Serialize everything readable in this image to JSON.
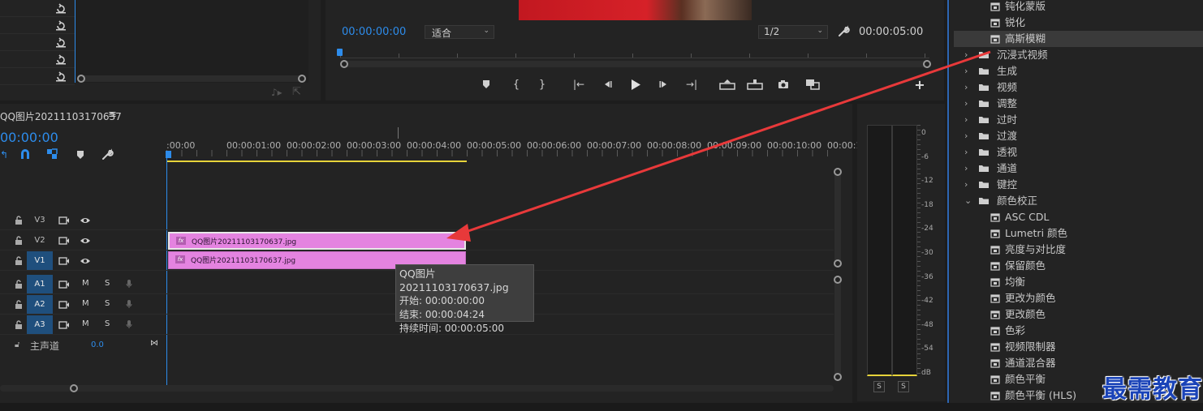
{
  "program_monitor": {
    "current_time": "00:00:00:00",
    "fit_option": "适合",
    "resolution": "1/2",
    "duration": "00:00:05:00"
  },
  "timeline": {
    "sequence_name": "QQ图片20211103170637",
    "timecode": "00:00:00",
    "ruler": [
      ":00:00",
      "00:00:01:00",
      "00:00:02:00",
      "00:00:03:00",
      "00:00:04:00",
      "00:00:05:00",
      "00:00:06:00",
      "00:00:07:00",
      "00:00:08:00",
      "00:00:09:00",
      "00:00:10:00",
      "00:00:1"
    ],
    "video_tracks": [
      {
        "name": "V3",
        "selected": false
      },
      {
        "name": "V2",
        "selected": false
      },
      {
        "name": "V1",
        "selected": true
      }
    ],
    "audio_tracks": [
      {
        "name": "A1",
        "mute": "M",
        "solo": "S"
      },
      {
        "name": "A2",
        "mute": "M",
        "solo": "S"
      },
      {
        "name": "A3",
        "mute": "M",
        "solo": "S"
      }
    ],
    "master": {
      "label": "主声道",
      "value": "0.0"
    },
    "clips": [
      {
        "track": "V2",
        "fx": "fx",
        "name": "QQ图片20211103170637.jpg"
      },
      {
        "track": "V1",
        "fx": "fx",
        "name": "QQ图片20211103170637.jpg"
      }
    ],
    "tooltip": {
      "name": "QQ图片20211103170637.jpg",
      "start": "开始: 00:00:00:00",
      "end": "结束: 00:00:04:24",
      "duration": "持续时间: 00:00:05:00"
    }
  },
  "audio_meter": {
    "scale": [
      "0",
      "-6",
      "-12",
      "-18",
      "-24",
      "-30",
      "-36",
      "-42",
      "-48",
      "-54",
      "dB"
    ],
    "solo_labels": [
      "S",
      "S"
    ]
  },
  "effects_panel": {
    "items": [
      {
        "type": "effect",
        "label": "钝化蒙版",
        "indent": 2
      },
      {
        "type": "effect",
        "label": "锐化",
        "indent": 2
      },
      {
        "type": "effect",
        "label": "高斯模糊",
        "indent": 2,
        "highlighted": true
      },
      {
        "type": "folder",
        "label": "沉浸式视频",
        "expanded": false
      },
      {
        "type": "folder",
        "label": "生成",
        "expanded": false
      },
      {
        "type": "folder",
        "label": "视频",
        "expanded": false
      },
      {
        "type": "folder",
        "label": "调整",
        "expanded": false
      },
      {
        "type": "folder",
        "label": "过时",
        "expanded": false
      },
      {
        "type": "folder",
        "label": "过渡",
        "expanded": false
      },
      {
        "type": "folder",
        "label": "透视",
        "expanded": false
      },
      {
        "type": "folder",
        "label": "通道",
        "expanded": false
      },
      {
        "type": "folder",
        "label": "键控",
        "expanded": false
      },
      {
        "type": "folder",
        "label": "颜色校正",
        "expanded": true
      },
      {
        "type": "effect",
        "label": "ASC CDL",
        "indent": 2
      },
      {
        "type": "effect",
        "label": "Lumetri 颜色",
        "indent": 2
      },
      {
        "type": "effect",
        "label": "亮度与对比度",
        "indent": 2
      },
      {
        "type": "effect",
        "label": "保留颜色",
        "indent": 2
      },
      {
        "type": "effect",
        "label": "均衡",
        "indent": 2
      },
      {
        "type": "effect",
        "label": "更改为颜色",
        "indent": 2
      },
      {
        "type": "effect",
        "label": "更改颜色",
        "indent": 2
      },
      {
        "type": "effect",
        "label": "色彩",
        "indent": 2
      },
      {
        "type": "effect",
        "label": "视频限制器",
        "indent": 2
      },
      {
        "type": "effect",
        "label": "通道混合器",
        "indent": 2
      },
      {
        "type": "effect",
        "label": "颜色平衡",
        "indent": 2
      },
      {
        "type": "effect",
        "label": "颜色平衡 (HLS)",
        "indent": 2
      }
    ]
  },
  "watermark": "最需教育",
  "colors": {
    "accent_blue": "#2d8ceb",
    "clip_pink": "#e483e0",
    "arrow_red": "#e8393a",
    "yellow_work_area": "#e6d33a"
  }
}
